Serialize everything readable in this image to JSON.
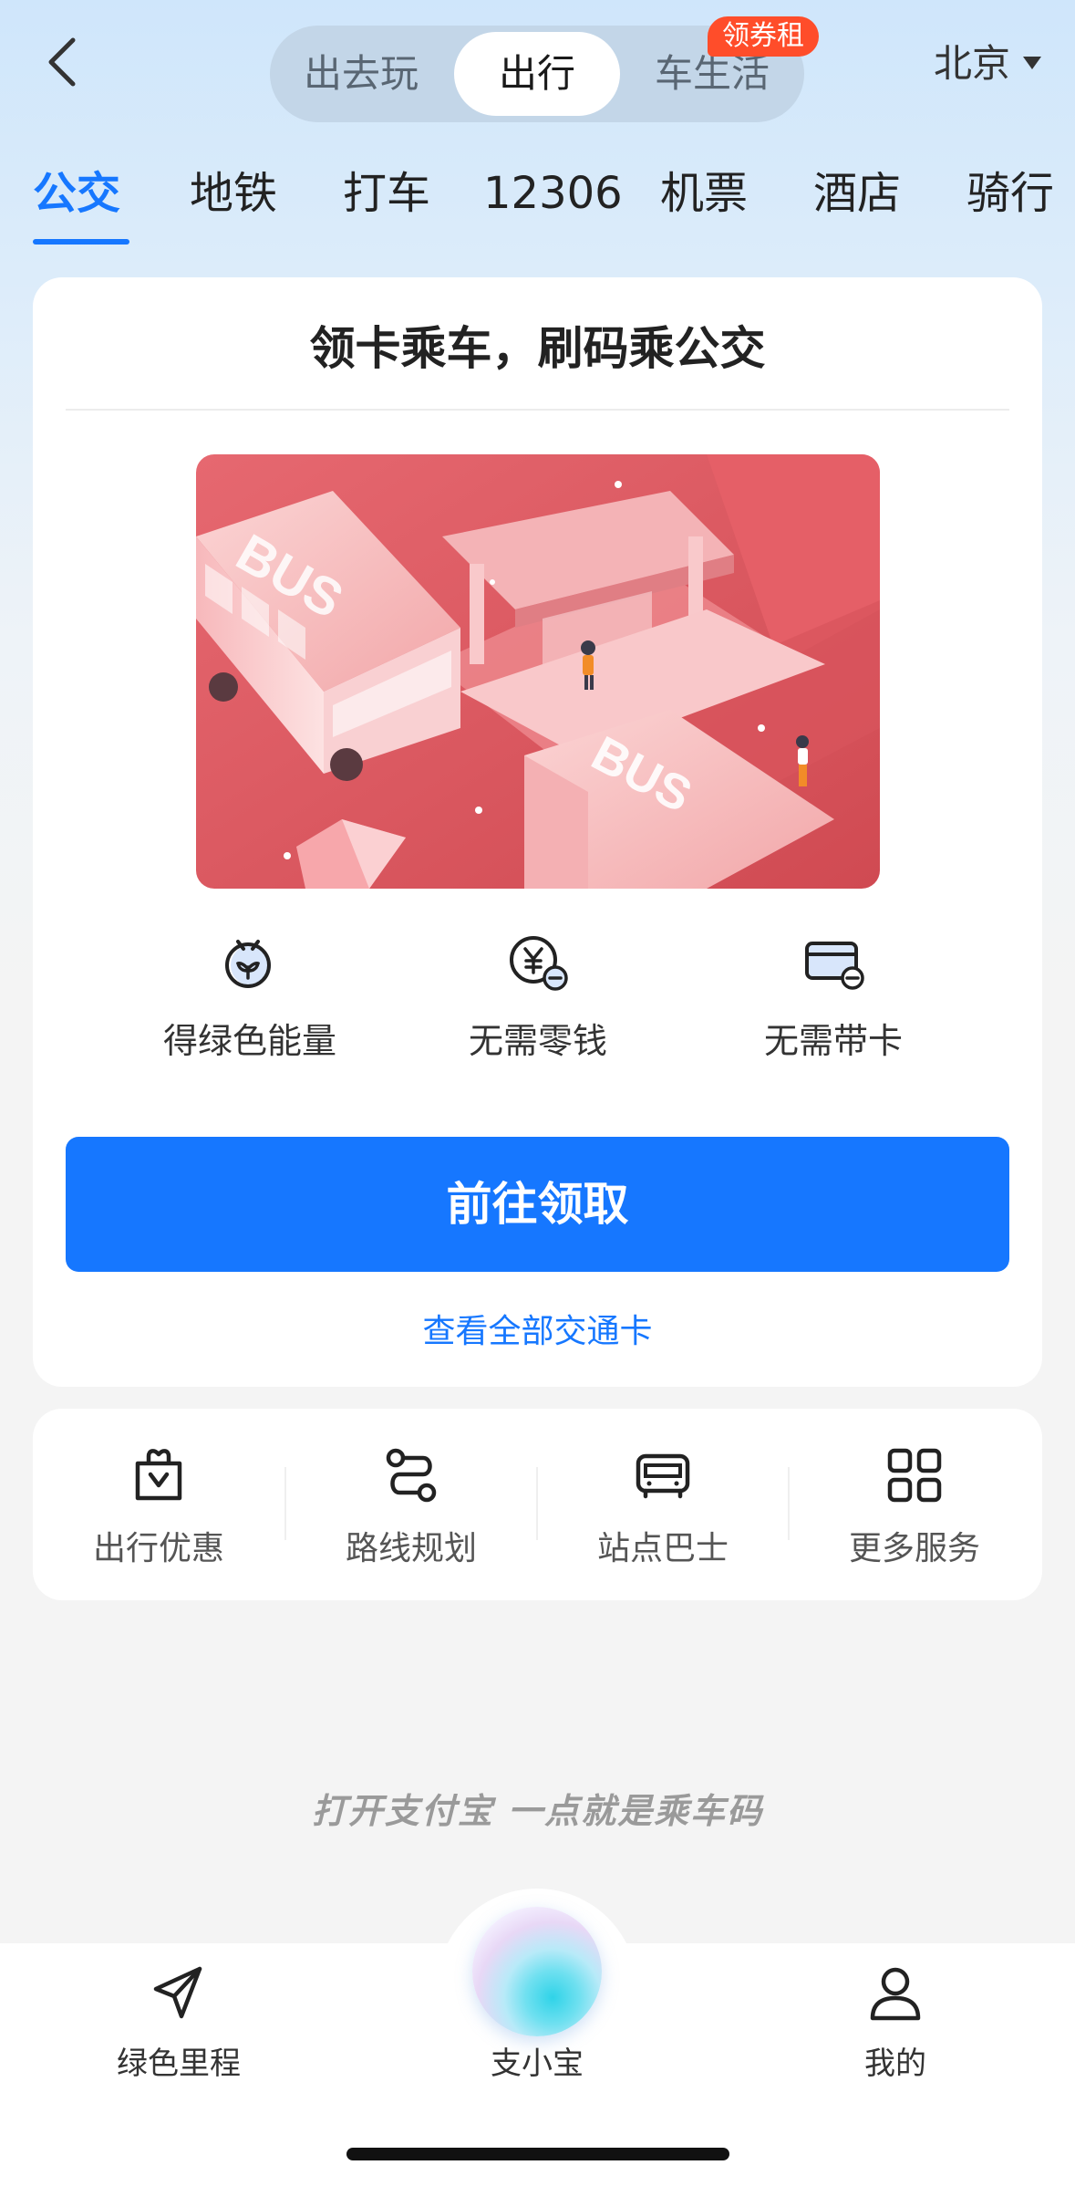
{
  "header": {
    "segments": [
      {
        "label": "出去玩"
      },
      {
        "label": "出行"
      },
      {
        "label": "车生活"
      }
    ],
    "segment_badge": "领券租",
    "city": "北京"
  },
  "categories": [
    {
      "label": "公交"
    },
    {
      "label": "地铁"
    },
    {
      "label": "打车"
    },
    {
      "label": "12306"
    },
    {
      "label": "机票"
    },
    {
      "label": "酒店"
    },
    {
      "label": "骑行"
    }
  ],
  "card": {
    "title": "领卡乘车，刷码乘公交",
    "illustration_text": [
      "BUS",
      "BUS"
    ],
    "features": [
      {
        "label": "得绿色能量",
        "icon": "green-energy-icon"
      },
      {
        "label": "无需零钱",
        "icon": "no-change-icon"
      },
      {
        "label": "无需带卡",
        "icon": "no-card-icon"
      }
    ],
    "cta": "前往领取",
    "link": "查看全部交通卡"
  },
  "services": [
    {
      "label": "出行优惠",
      "icon": "gift-bag-icon"
    },
    {
      "label": "路线规划",
      "icon": "route-icon"
    },
    {
      "label": "站点巴士",
      "icon": "bus-icon"
    },
    {
      "label": "更多服务",
      "icon": "grid-icon"
    }
  ],
  "slogan": "打开支付宝 一点就是乘车码",
  "tabbar": [
    {
      "label": "绿色里程",
      "icon": "paper-plane-icon"
    },
    {
      "label": "支小宝",
      "icon": "assistant-orb-icon"
    },
    {
      "label": "我的",
      "icon": "user-icon"
    }
  ],
  "colors": {
    "accent": "#1677ff",
    "badge": "#ff4d2a",
    "illustration_bg": "#e05a5f"
  }
}
